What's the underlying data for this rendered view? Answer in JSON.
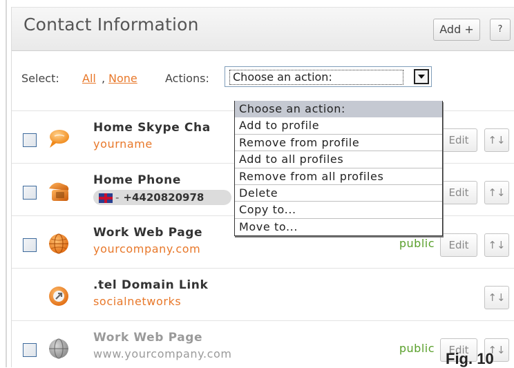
{
  "header": {
    "title": "Contact Information",
    "add_label": "Add +",
    "help_label": "?"
  },
  "select_bar": {
    "select_label": "Select:",
    "all_link": "All",
    "separator": ",",
    "none_link": "None",
    "actions_label": "Actions:",
    "action_value": "Choose an action:"
  },
  "action_options": [
    "Choose an action:",
    "Add to profile",
    "Remove from profile",
    "Add to all profiles",
    "Remove from all profiles",
    "Delete",
    "Copy to...",
    "Move to..."
  ],
  "rows": [
    {
      "title": "Home Skype Cha",
      "subtitle": "yourname",
      "visibility": "",
      "edit": "Edit",
      "sort": "↑↓",
      "icon": "skype-chat-icon"
    },
    {
      "title": "Home Phone",
      "subtitle": "+4420820978",
      "country_code_symbol": "-",
      "visibility": "",
      "edit": "Edit",
      "sort": "↑↓",
      "icon": "phone-icon"
    },
    {
      "title": "Work Web Page",
      "subtitle": "yourcompany.com",
      "visibility": "public",
      "edit": "Edit",
      "sort": "↑↓",
      "icon": "globe-icon"
    },
    {
      "title": ".tel Domain Link",
      "subtitle": "socialnetworks",
      "sort": "↑↓",
      "icon": "tel-link-icon"
    },
    {
      "title": "Work Web Page",
      "subtitle": "www.yourcompany.com",
      "visibility": "public",
      "edit": "Edit",
      "sort": "↑↓",
      "icon": "globe-gray-icon"
    }
  ],
  "figure_label": "Fig. 10",
  "colors": {
    "link": "#e8782a",
    "public": "#5aa02c",
    "selected_option": "#c5c9d2"
  }
}
